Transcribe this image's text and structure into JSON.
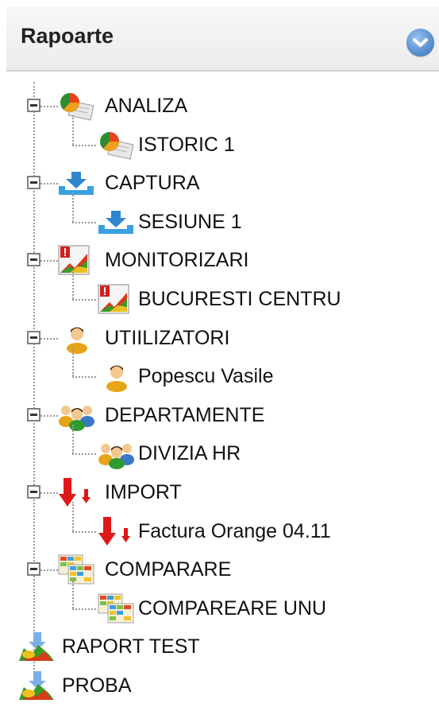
{
  "panel": {
    "title": "Rapoarte",
    "collapse_icon": "chevron-down-icon"
  },
  "tree": [
    {
      "label": "ANALIZA",
      "icon": "pie-chart-report-icon",
      "children": [
        {
          "label": "ISTORIC 1",
          "icon": "pie-chart-report-icon"
        }
      ]
    },
    {
      "label": "CAPTURA",
      "icon": "download-tray-icon",
      "children": [
        {
          "label": "SESIUNE 1",
          "icon": "download-tray-icon"
        }
      ]
    },
    {
      "label": "MONITORIZARI",
      "icon": "monitoring-chart-icon",
      "children": [
        {
          "label": "BUCURESTI CENTRU",
          "icon": "monitoring-chart-icon"
        }
      ]
    },
    {
      "label": "UTIILIZATORI",
      "icon": "user-icon",
      "children": [
        {
          "label": "Popescu Vasile",
          "icon": "user-icon"
        }
      ]
    },
    {
      "label": "DEPARTAMENTE",
      "icon": "users-group-icon",
      "children": [
        {
          "label": "DIVIZIA HR",
          "icon": "users-group-icon"
        }
      ]
    },
    {
      "label": "IMPORT",
      "icon": "import-arrow-icon",
      "children": [
        {
          "label": "Factura Orange 04.11",
          "icon": "import-arrow-icon"
        }
      ]
    },
    {
      "label": "COMPARARE",
      "icon": "compare-table-icon",
      "children": [
        {
          "label": "COMPAREARE UNU",
          "icon": "compare-table-icon"
        }
      ]
    },
    {
      "label": "RAPORT TEST",
      "icon": "report-chart-icon",
      "children": []
    },
    {
      "label": "PROBA",
      "icon": "report-chart-icon",
      "children": []
    }
  ]
}
